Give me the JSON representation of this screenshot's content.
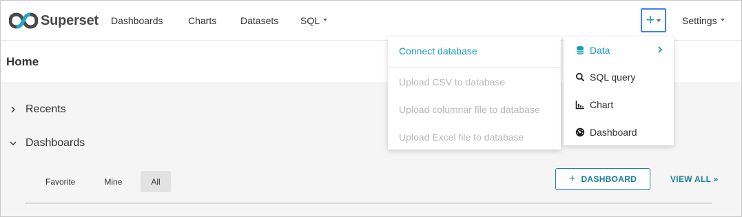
{
  "brand": {
    "name": "Superset"
  },
  "nav": {
    "dashboards": "Dashboards",
    "charts": "Charts",
    "datasets": "Datasets",
    "sql": "SQL",
    "plus": "+",
    "settings": "Settings"
  },
  "page": {
    "title": "Home"
  },
  "sections": {
    "recents": "Recents",
    "dashboards": "Dashboards"
  },
  "tabs": [
    "Favorite",
    "Mine",
    "All"
  ],
  "actions": {
    "add_dashboard_plus": "+",
    "add_dashboard": "DASHBOARD",
    "view_all": "VIEW ALL »"
  },
  "new_menu": {
    "items": [
      {
        "label": "Data",
        "icon": "database-icon",
        "has_submenu": true,
        "active": true
      },
      {
        "label": "SQL query",
        "icon": "search-icon"
      },
      {
        "label": "Chart",
        "icon": "chart-icon"
      },
      {
        "label": "Dashboard",
        "icon": "dashboard-icon"
      }
    ]
  },
  "data_submenu": {
    "items": [
      {
        "label": "Connect database",
        "enabled": true
      },
      {
        "label": "Upload CSV to database",
        "enabled": false
      },
      {
        "label": "Upload columnar file to database",
        "enabled": false
      },
      {
        "label": "Upload Excel file to database",
        "enabled": false
      }
    ]
  },
  "colors": {
    "accent": "#1a9dbd",
    "primary_dark": "#1a7f9c",
    "focus_border": "#3b82f6",
    "disabled_text": "#b8b8b8",
    "background": "#f5f5f5"
  }
}
